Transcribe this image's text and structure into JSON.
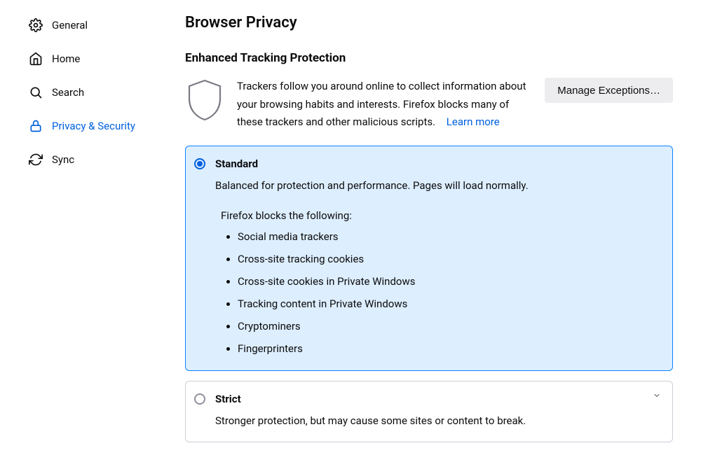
{
  "sidebar": {
    "items": [
      {
        "label": "General"
      },
      {
        "label": "Home"
      },
      {
        "label": "Search"
      },
      {
        "label": "Privacy & Security"
      },
      {
        "label": "Sync"
      }
    ]
  },
  "page": {
    "title": "Browser Privacy"
  },
  "etp": {
    "heading": "Enhanced Tracking Protection",
    "desc": "Trackers follow you around online to collect information about your browsing habits and interests. Firefox blocks many of these trackers and other malicious scripts.",
    "learn_more": "Learn more",
    "manage_exceptions": "Manage Exceptions…"
  },
  "options": {
    "standard": {
      "title": "Standard",
      "desc": "Balanced for protection and performance. Pages will load normally.",
      "blocks_intro": "Firefox blocks the following:",
      "blocks": [
        "Social media trackers",
        "Cross-site tracking cookies",
        "Cross-site cookies in Private Windows",
        "Tracking content in Private Windows",
        "Cryptominers",
        "Fingerprinters"
      ]
    },
    "strict": {
      "title": "Strict",
      "desc": "Stronger protection, but may cause some sites or content to break."
    }
  }
}
